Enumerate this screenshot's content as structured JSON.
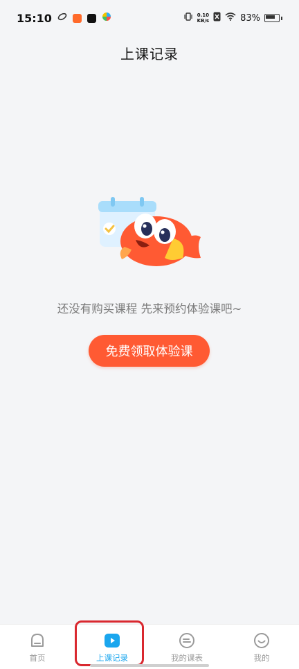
{
  "status_bar": {
    "time": "15:10",
    "net_speed_value": "0.10",
    "net_speed_unit": "KB/s",
    "battery": "83%"
  },
  "header": {
    "title": "上课记录"
  },
  "empty_state": {
    "message": "还没有购买课程 先来预约体验课吧~",
    "cta_label": "免费领取体验课"
  },
  "tabs": [
    {
      "label": "首页",
      "icon": "home-icon",
      "active": false
    },
    {
      "label": "上课记录",
      "icon": "play-icon",
      "active": true
    },
    {
      "label": "我的课表",
      "icon": "schedule-icon",
      "active": false
    },
    {
      "label": "我的",
      "icon": "smile-icon",
      "active": false
    }
  ],
  "colors": {
    "accent": "#1aa6ee",
    "cta": "#ff5a33",
    "highlight": "#d9282f",
    "background": "#f4f5f7"
  }
}
